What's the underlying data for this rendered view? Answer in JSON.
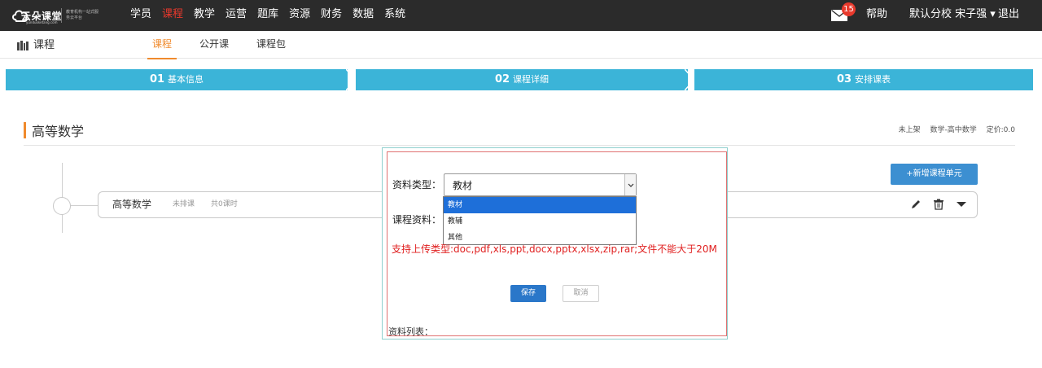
{
  "topbar": {
    "logo_text": "云朵课堂",
    "logo_sub": "yunduoketang.com",
    "logo_slogan": "教育机构一站式服务云平台",
    "nav": [
      {
        "label": "学员",
        "active": false
      },
      {
        "label": "课程",
        "active": true
      },
      {
        "label": "教学",
        "active": false
      },
      {
        "label": "运营",
        "active": false
      },
      {
        "label": "题库",
        "active": false
      },
      {
        "label": "资源",
        "active": false
      },
      {
        "label": "财务",
        "active": false
      },
      {
        "label": "数据",
        "active": false
      },
      {
        "label": "系统",
        "active": false
      }
    ],
    "mail_count": "15",
    "help": "帮助",
    "school_user": "默认分校 宋子强 ▾",
    "logout": "退出"
  },
  "subbar": {
    "title": "课程",
    "tabs": [
      {
        "label": "课程",
        "active": true
      },
      {
        "label": "公开课",
        "active": false
      },
      {
        "label": "课程包",
        "active": false
      }
    ]
  },
  "steps": [
    {
      "num": "01",
      "label": "基本信息"
    },
    {
      "num": "02",
      "label": "课程详细"
    },
    {
      "num": "03",
      "label": "安排课表"
    }
  ],
  "course": {
    "title": "高等数学",
    "status": "未上架",
    "category": "数学-高中数学",
    "price": "定价:0.0"
  },
  "unit": {
    "name": "高等数学",
    "status": "未排课",
    "hours": "共0课时",
    "add_label": "+新增课程单元"
  },
  "dialog": {
    "type_label": "资料类型：",
    "type_value": "教材",
    "options": [
      "教材",
      "教辅",
      "其他"
    ],
    "selected_index": 0,
    "resource_label": "课程资料：",
    "upload_note": "支持上传类型:doc,pdf,xls,ppt,docx,pptx,xlsx,zip,rar;文件不能大于20M",
    "save": "保存",
    "cancel": "取消",
    "list_label": "资料列表："
  },
  "colors": {
    "topbar": "#2b2b2b",
    "active_nav": "#e8392c",
    "accent_orange": "#f08a2c",
    "step_blue": "#3bb4d8",
    "button_blue": "#2a77c9",
    "warning_red": "#e02020"
  }
}
